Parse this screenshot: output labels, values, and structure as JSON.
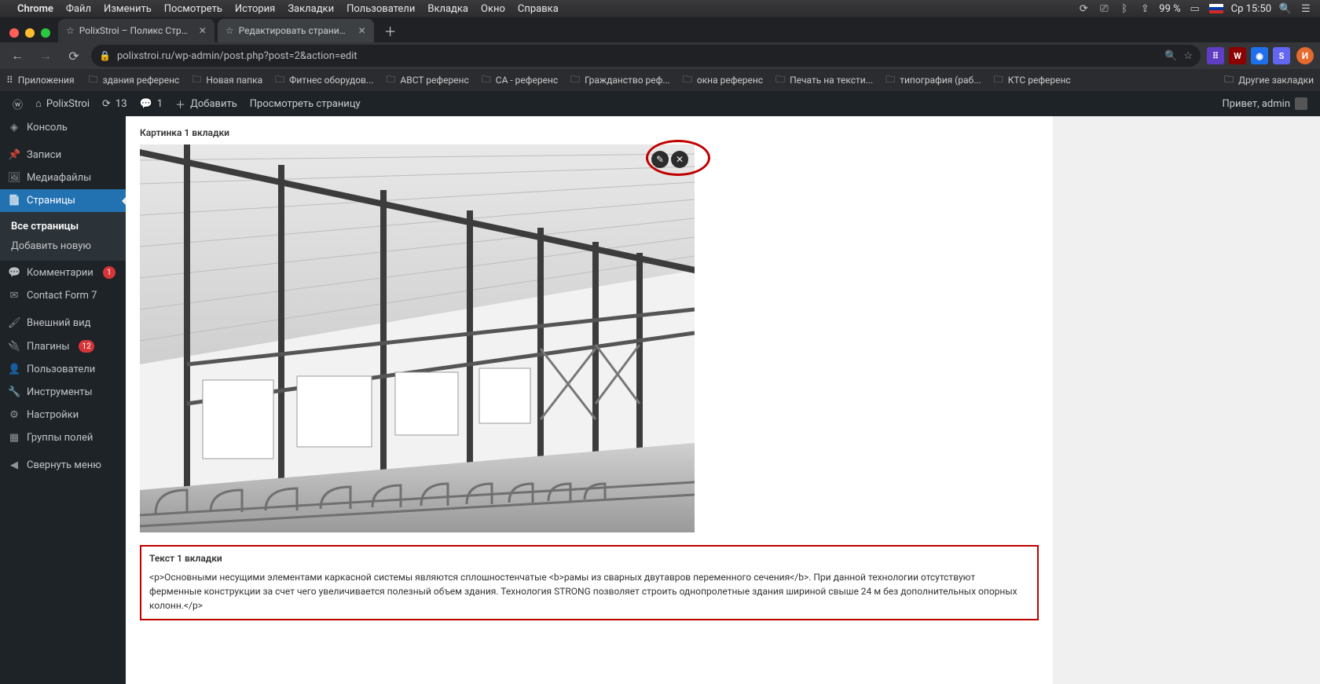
{
  "mac_menu": {
    "app": "Chrome",
    "items": [
      "Файл",
      "Изменить",
      "Посмотреть",
      "История",
      "Закладки",
      "Пользователи",
      "Вкладка",
      "Окно",
      "Справка"
    ],
    "battery": "99 %",
    "battery_icon": "🔋",
    "clock": "Ср 15:50"
  },
  "browser": {
    "tabs": [
      {
        "title": "PolixStroi – Поликс Строй – с..."
      },
      {
        "title": "Редактировать страницу ‹ Pc..."
      }
    ],
    "url": "polixstroi.ru/wp-admin/post.php?post=2&action=edit",
    "bookmarks_label": "Приложения",
    "bookmarks": [
      "здания референс",
      "Новая папка",
      "Фитнес оборудов...",
      "ABCT референс",
      "CA - референс",
      "Гражданство реф...",
      "окна референс",
      "Печать на тексти...",
      "типография (раб...",
      "КТС референс"
    ],
    "other_bookmarks": "Другие закладки",
    "avatar_letter": "И"
  },
  "wp_adminbar": {
    "site": "PolixStroi",
    "updates": "13",
    "comments": "1",
    "add": "Добавить",
    "view": "Просмотреть страницу",
    "greeting": "Привет, admin"
  },
  "wp_sidebar": {
    "items": [
      {
        "icon": "◈",
        "label": "Консоль"
      },
      {
        "icon": "📌",
        "label": "Записи"
      },
      {
        "icon": "🖼",
        "label": "Медиафайлы"
      },
      {
        "icon": "📄",
        "label": "Страницы",
        "current": true
      },
      {
        "icon": "💬",
        "label": "Комментарии",
        "badge": "1"
      },
      {
        "icon": "✉",
        "label": "Contact Form 7"
      },
      {
        "icon": "🖌",
        "label": "Внешний вид"
      },
      {
        "icon": "🔌",
        "label": "Плагины",
        "badge": "12"
      },
      {
        "icon": "👤",
        "label": "Пользователи"
      },
      {
        "icon": "🔧",
        "label": "Инструменты"
      },
      {
        "icon": "⚙",
        "label": "Настройки"
      },
      {
        "icon": "▦",
        "label": "Группы полей"
      },
      {
        "icon": "◀",
        "label": "Свернуть меню"
      }
    ],
    "submenu": [
      "Все страницы",
      "Добавить новую"
    ]
  },
  "content": {
    "image_label": "Картинка 1 вкладки",
    "text_label": "Текст 1 вкладки",
    "text_value": "<p>Основными несущими элементами каркасной системы являются сплошностенчатые <b>рамы из сварных двутавров переменного сечения</b>. При данной технологии отсутствуют ферменные конструкции за счет чего увеличивается полезный объем здания. Технология STRONG позволяет строить однопролетные здания шириной свыше 24 м без дополнительных опорных колонн.</p>"
  }
}
